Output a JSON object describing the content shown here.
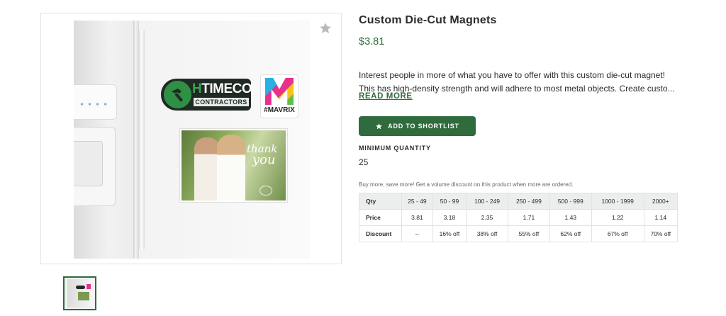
{
  "product": {
    "title": "Custom Die-Cut Magnets",
    "price": "$3.81",
    "description_line1": "Interest people in more of what you have to offer with this custom die-cut magnet!",
    "description_line2": "This has high-density strength and will adhere to most metal objects. Create custo...",
    "read_more": "READ MORE",
    "shortlist_button": "ADD TO SHORTLIST",
    "min_quantity_label": "MINIMUM QUANTITY",
    "min_quantity_value": "25",
    "volume_note": "Buy more, save more! Get a volume discount on this product when more are ordered."
  },
  "image": {
    "magnet1_big_h": "H",
    "magnet1_big_rest": "TIMECO",
    "magnet1_small": "CONTRACTORS",
    "magnet2_tag": "#MAVRIX",
    "magnet3_text_line1": "thank",
    "magnet3_text_line2": "you"
  },
  "icons": {
    "favorite": "star-icon",
    "shortlist": "star-icon"
  },
  "pricing_table": {
    "headers": [
      "Qty",
      "25 - 49",
      "50 - 99",
      "100 - 249",
      "250 - 499",
      "500 - 999",
      "1000 - 1999",
      "2000+"
    ],
    "rows": [
      [
        "Price",
        "3.81",
        "3.18",
        "2.35",
        "1.71",
        "1.43",
        "1.22",
        "1.14"
      ],
      [
        "Discount",
        "--",
        "16% off",
        "38% off",
        "55% off",
        "62% off",
        "67% off",
        "70% off"
      ]
    ]
  },
  "colors": {
    "accent": "#2f6b3d",
    "table_header_bg": "#ebeeed",
    "favorite_star": "#b9b9b9"
  }
}
